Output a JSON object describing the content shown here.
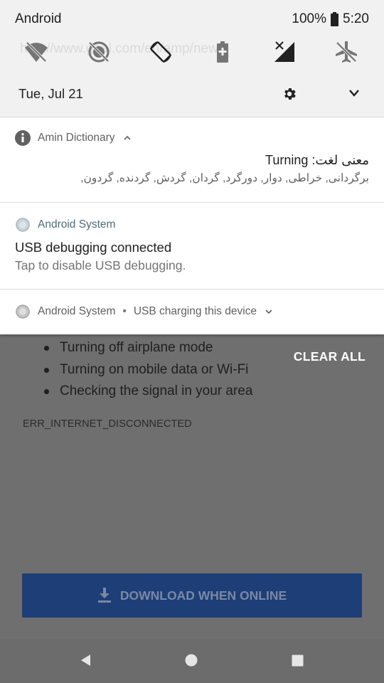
{
  "status_bar": {
    "carrier": "Android",
    "battery": "100%",
    "time": "5:20"
  },
  "quick_settings": {
    "ghost_url": "http://www.goal.com/en/amp/news/",
    "date": "Tue, Jul 21",
    "tiles": [
      "wifi-off-icon",
      "data-saver-off-icon",
      "auto-rotate-icon",
      "battery-saver-icon",
      "mobile-data-off-icon",
      "airplane-mode-off-icon"
    ]
  },
  "notifications": [
    {
      "app": "Amin Dictionary",
      "title": "معنی لغت: Turning",
      "body": "برگردانی, خراطی, دوار, دورگرد, گردان, گردش, گردنده, گردون,"
    },
    {
      "app": "Android System",
      "title": "USB debugging connected",
      "body": "Tap to disable USB debugging."
    },
    {
      "app": "Android System",
      "separator": "•",
      "summary": "USB charging this device"
    }
  ],
  "clear_all": "CLEAR ALL",
  "background_page": {
    "suggestions": [
      "Turning off airplane mode",
      "Turning on mobile data or Wi-Fi",
      "Checking the signal in your area"
    ],
    "error_code": "ERR_INTERNET_DISCONNECTED",
    "download_button": "DOWNLOAD WHEN ONLINE"
  },
  "colors": {
    "shade": "#ffffff",
    "quick_settings": "#f1f1f1",
    "dim_background": "#6f6f6f",
    "download_button": "#1d3e77",
    "android_system_app": "#4f6b7c"
  }
}
